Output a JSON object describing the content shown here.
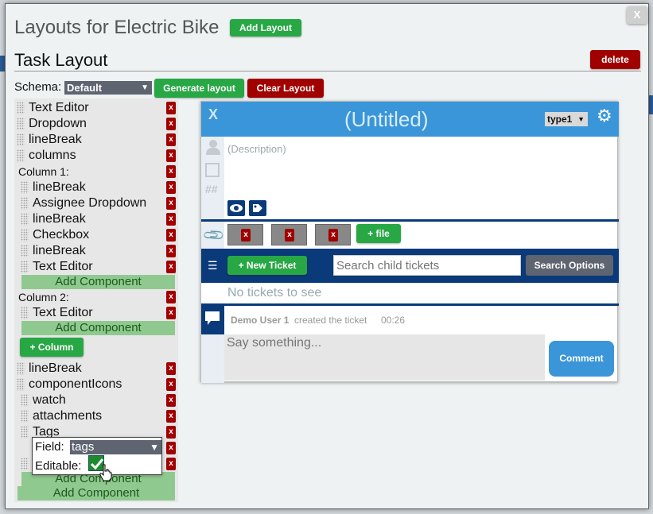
{
  "modal": {
    "title": "Layouts for Electric Bike",
    "add_layout_label": "Add Layout",
    "close_label": "X"
  },
  "task": {
    "title": "Task Layout",
    "delete_label": "delete",
    "schema_label": "Schema:",
    "schema_value": "Default",
    "generate_label": "Generate layout",
    "clear_label": "Clear Layout"
  },
  "tree": {
    "items_top": [
      "Text Editor",
      "Dropdown",
      "lineBreak",
      "columns"
    ],
    "column1_title": "Column 1:",
    "column1_items": [
      "lineBreak",
      "Assignee Dropdown",
      "lineBreak",
      "Checkbox",
      "lineBreak",
      "Text Editor"
    ],
    "column2_title": "Column 2:",
    "column2_items": [
      "Text Editor"
    ],
    "add_component": "Add Component",
    "add_column": "+ Column",
    "items_bottom": [
      "lineBreak",
      "componentIcons"
    ],
    "icons_items": [
      "watch",
      "attachments",
      "Tags"
    ],
    "remove_label": "x"
  },
  "popup": {
    "field_label": "Field:",
    "field_value": "tags",
    "editable_label": "Editable:",
    "editable_checked": true
  },
  "card": {
    "close_label": "X",
    "title": "(Untitled)",
    "type_value": "type1",
    "description_placeholder": "(Description)",
    "hash_label": "##",
    "attach_remove": [
      "x",
      "x",
      "x"
    ],
    "add_file_label": "+ file",
    "new_ticket_label": "+ New Ticket",
    "search_placeholder": "Search child tickets",
    "search_options_label": "Search Options",
    "no_tickets": "No tickets to see",
    "activity_user": "Demo User 1",
    "activity_text": "created the ticket",
    "activity_time": "00:26",
    "comment_placeholder": "Say something...",
    "comment_label": "Comment"
  },
  "colors": {
    "green": "#28a745",
    "red": "#a10000",
    "header_blue": "#3a96d8",
    "navy": "#0a3a7a"
  }
}
